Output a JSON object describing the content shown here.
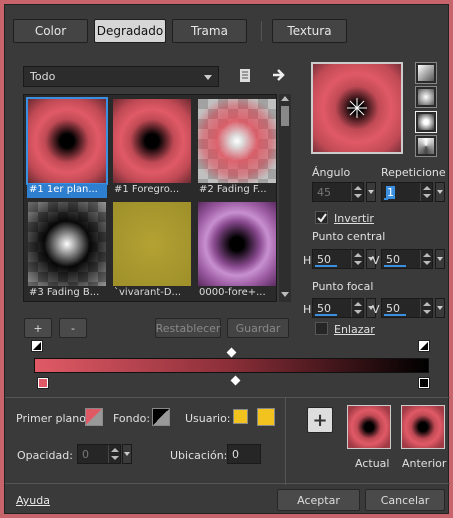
{
  "tabs": [
    {
      "label": "Color"
    },
    {
      "label": "Degradado"
    },
    {
      "label": "Trama"
    },
    {
      "label": "Textura"
    }
  ],
  "filter": {
    "selected": "Todo"
  },
  "gradients": [
    {
      "caption": "#1 1er plan..."
    },
    {
      "caption": "#1 Foregro..."
    },
    {
      "caption": "#2 Fading F..."
    },
    {
      "caption": "#3 Fading B..."
    },
    {
      "caption": "`vivarant-D..."
    },
    {
      "caption": "0000-fore+..."
    }
  ],
  "library_buttons": {
    "add": "+",
    "remove": "-",
    "reset": "Restablecer",
    "save": "Guardar"
  },
  "settings": {
    "angle_label": "Ángulo",
    "angle_value": "45",
    "repeats_label": "Repeticione",
    "repeats_value": "1",
    "invert_label": "Invertir",
    "invert_checked": true,
    "center_label": "Punto central",
    "center_h_label": "H",
    "center_h": "50",
    "center_v_label": "V",
    "center_v": "50",
    "focal_label": "Punto focal",
    "focal_h_label": "H",
    "focal_h": "50",
    "focal_v_label": "V",
    "focal_v": "50",
    "link_label": "Enlazar",
    "link_checked": false
  },
  "bottom": {
    "foreground_label": "Primer plano:",
    "background_label": "Fondo:",
    "user_label": "Usuario:",
    "opacity_label": "Opacidad:",
    "opacity_value": "0",
    "location_label": "Ubicación:",
    "location_value": "0",
    "current_label": "Actual",
    "previous_label": "Anterior",
    "add_symbol": "+"
  },
  "footer": {
    "help": "Ayuda",
    "ok": "Aceptar",
    "cancel": "Cancelar"
  },
  "colors": {
    "accent": "#3a8fe0",
    "gradient_start": "#e05a66",
    "gradient_end": "#000000",
    "user_swatch": "#f2c21e"
  }
}
